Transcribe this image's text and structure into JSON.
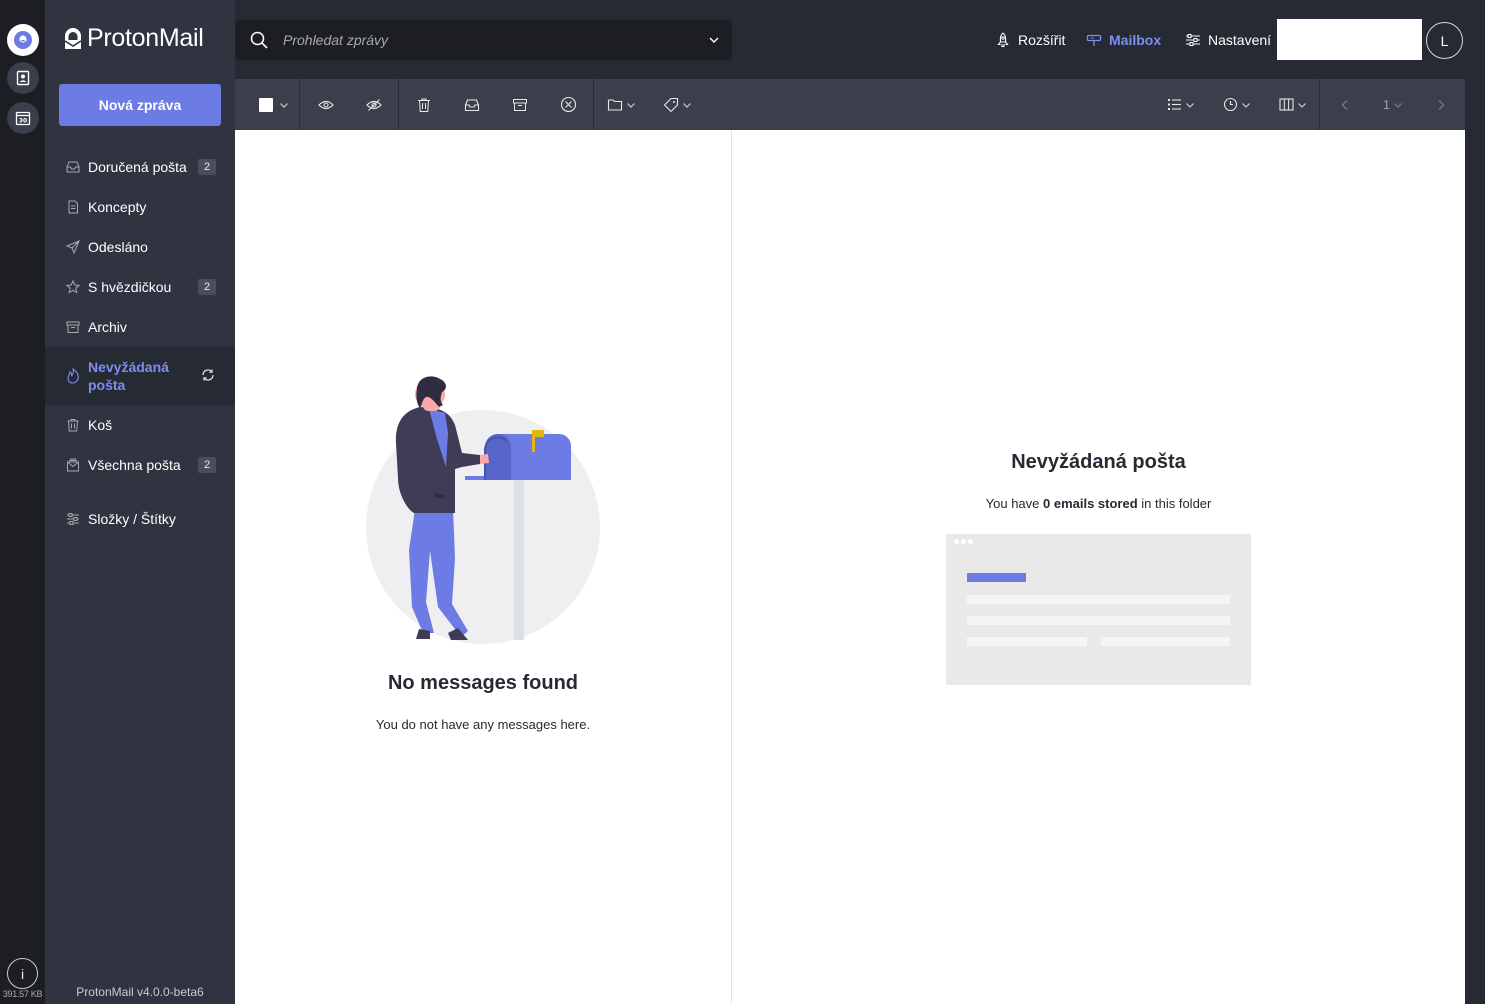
{
  "app": {
    "logo_text": "ProtonMail",
    "version": "ProtonMail v4.0.0-beta6",
    "storage": "391.57 KB",
    "info_label": "i"
  },
  "rail": {
    "items": [
      {
        "name": "mail-app",
        "icon": "mail-app-icon",
        "active": true
      },
      {
        "name": "contacts-app",
        "icon": "contacts-icon",
        "active": false
      },
      {
        "name": "calendar-app",
        "icon": "calendar-icon",
        "active": false
      }
    ]
  },
  "compose": {
    "label": "Nová zpráva"
  },
  "sidebar": {
    "items": [
      {
        "label": "Doručená pošta",
        "icon": "inbox-icon",
        "count": "2"
      },
      {
        "label": "Koncepty",
        "icon": "draft-icon",
        "count": ""
      },
      {
        "label": "Odesláno",
        "icon": "paper-plane-icon",
        "count": ""
      },
      {
        "label": "S hvězdičkou",
        "icon": "star-icon",
        "count": "2"
      },
      {
        "label": "Archiv",
        "icon": "archive-icon",
        "count": ""
      },
      {
        "label": "Nevyžádaná pošta",
        "icon": "fire-icon",
        "count": "",
        "active": true
      },
      {
        "label": "Koš",
        "icon": "trash-icon",
        "count": ""
      },
      {
        "label": "Všechna pošta",
        "icon": "all-mail-icon",
        "count": "2"
      },
      {
        "label": "Složky / Štítky",
        "icon": "sliders-icon",
        "count": ""
      }
    ]
  },
  "search": {
    "placeholder": "Prohledat zprávy"
  },
  "topnav": {
    "upgrade": "Rozšířit",
    "mailbox": "Mailbox",
    "settings": "Nastavení",
    "avatar_initial": "L"
  },
  "toolbar": {
    "page": "1"
  },
  "colors": {
    "accent": "#6d7be5",
    "accent_text": "#7f8cf0",
    "sidebar_bg": "#303440",
    "rail_bg": "#1c1e24",
    "toolbar_bg": "#3b3f4b",
    "page_bg": "#262a33"
  },
  "list": {
    "empty_title": "No messages found",
    "empty_sub": "You do not have any messages here."
  },
  "view": {
    "folder_title": "Nevyžádaná pošta",
    "sub_before": "You have ",
    "sub_bold": "0 emails stored",
    "sub_after": " in this folder"
  }
}
